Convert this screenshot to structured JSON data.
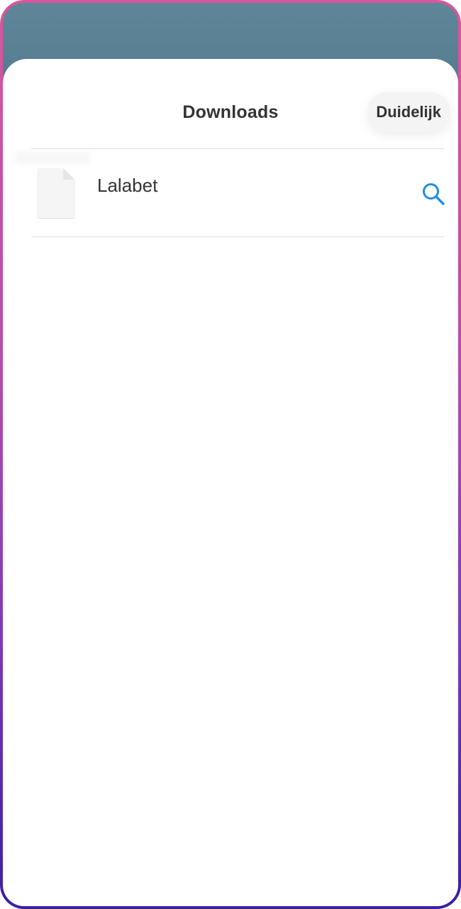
{
  "sheet": {
    "title": "Downloads",
    "clear_label": "Duidelijk"
  },
  "downloads": [
    {
      "name": "Lalabet",
      "meta": "",
      "icon": "file-icon",
      "action_icon": "search-icon"
    }
  ],
  "colors": {
    "accent": "#1a8fe3",
    "text": "#333333",
    "divider": "#dcdcdc",
    "backdrop": "#567a91"
  }
}
